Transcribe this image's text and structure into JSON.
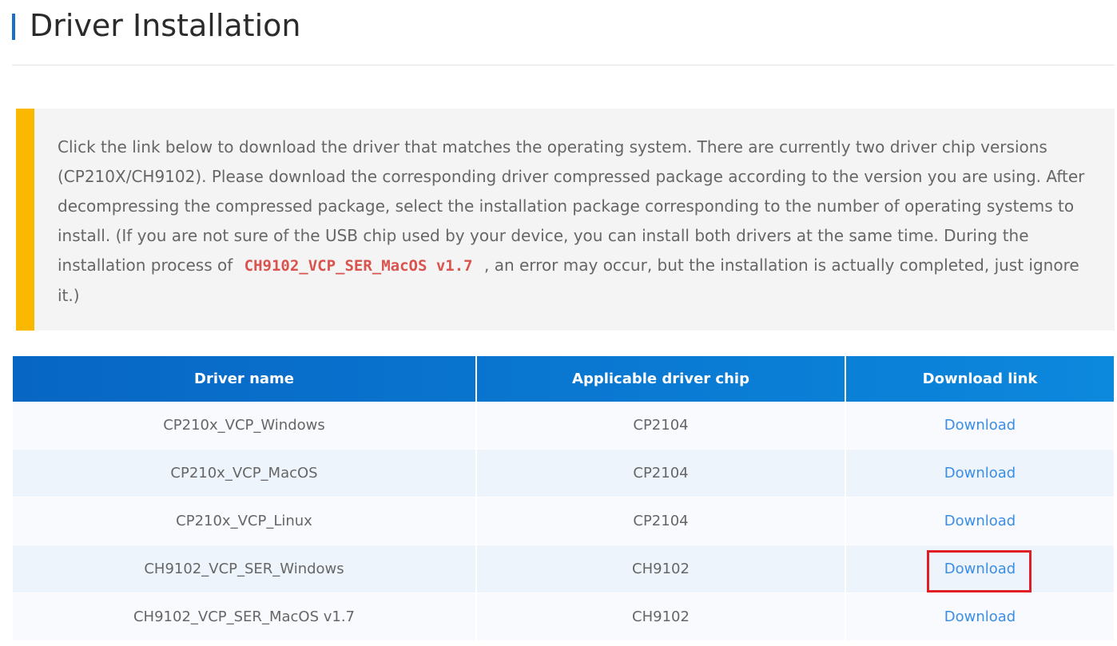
{
  "page": {
    "title": "Driver Installation",
    "accent_color": "#1a6fc7"
  },
  "notice": {
    "text_before": "Click the link below to download the driver that matches the operating system. There are currently two driver chip versions (CP210X/CH9102). Please download the corresponding driver compressed package according to the version you are using. After decompressing the compressed package, select the installation package corresponding to the number of operating systems to install. (If you are not sure of the USB chip used by your device, you can install both drivers at the same time. During the installation process of",
    "code": "CH9102_VCP_SER_MacOS v1.7",
    "text_after": ", an error may occur, but the installation is actually completed, just ignore it.)",
    "accent_color": "#fbb800",
    "code_color": "#d9534f"
  },
  "table": {
    "headers": [
      "Driver name",
      "Applicable driver chip",
      "Download link"
    ],
    "rows": [
      {
        "driver": "CP210x_VCP_Windows",
        "chip": "CP2104",
        "link": "Download"
      },
      {
        "driver": "CP210x_VCP_MacOS",
        "chip": "CP2104",
        "link": "Download"
      },
      {
        "driver": "CP210x_VCP_Linux",
        "chip": "CP2104",
        "link": "Download"
      },
      {
        "driver": "CH9102_VCP_SER_Windows",
        "chip": "CH9102",
        "link": "Download"
      },
      {
        "driver": "CH9102_VCP_SER_MacOS v1.7",
        "chip": "CH9102",
        "link": "Download"
      }
    ],
    "header_color": "#0766c4",
    "link_color": "#3a8ee6"
  },
  "annotation": {
    "highlight_color": "#e01e25",
    "highlighted_row": 4
  }
}
